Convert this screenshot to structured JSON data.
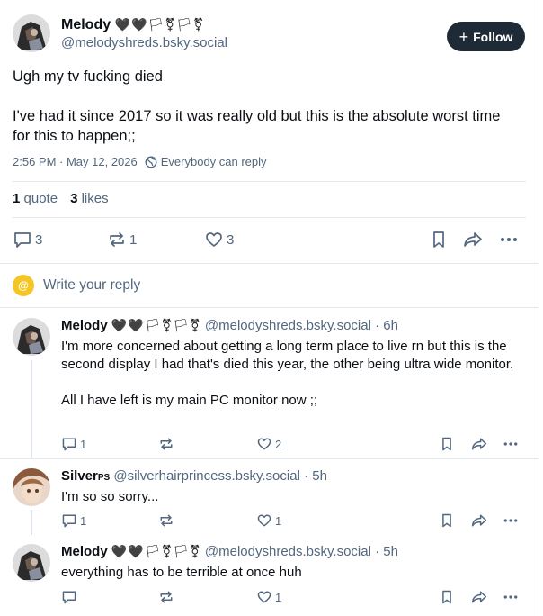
{
  "post": {
    "display_name": "Melody",
    "name_emojis": "🖤🖤🏳⚧🏳⚧",
    "handle": "@melodyshreds.bsky.social",
    "follow_label": "Follow",
    "text_line1": "Ugh my tv fucking died",
    "text_line2": "I've had it since 2017 so it was really old but this is the absolute worst time for this to happen;;",
    "timestamp": "2:56 PM · May 12, 2026",
    "reply_setting": "Everybody can reply",
    "quotes_count": "1",
    "quotes_label": "quote",
    "likes_count": "3",
    "likes_label": "likes",
    "actions": {
      "replies": "3",
      "reposts": "1",
      "likes": "3"
    }
  },
  "composer": {
    "placeholder": "Write your reply"
  },
  "replies": [
    {
      "display_name": "Melody",
      "name_emojis": "🖤🖤🏳⚧🏳⚧",
      "handle": "@melodyshreds.bsky.social",
      "age": " · 6h",
      "text_p1": "I'm more concerned about getting a long term place to live rn but this is the second display I had that's died this year, the other being ultra wide monitor.",
      "text_p2": "All I have left is my main PC monitor now ;;",
      "actions": {
        "replies": "1",
        "reposts": "",
        "likes": "2"
      }
    },
    {
      "display_name": "Silver",
      "name_suffix": "PS",
      "handle": "@silverhairprincess.bsky.social",
      "age": " · 5h",
      "text_p1": "I'm so so sorry...",
      "actions": {
        "replies": "1",
        "reposts": "",
        "likes": "1"
      }
    },
    {
      "display_name": "Melody",
      "name_emojis": "🖤🖤🏳⚧🏳⚧",
      "handle": "@melodyshreds.bsky.social",
      "age": " · 5h",
      "text_p1": "everything has to be terrible at once huh",
      "actions": {
        "replies": "",
        "reposts": "",
        "likes": "1"
      }
    }
  ],
  "colors": {
    "accent": "#1f2a37",
    "muted": "#52677f",
    "divider": "#e2e7ee",
    "composer_avatar": "#f3c623"
  }
}
